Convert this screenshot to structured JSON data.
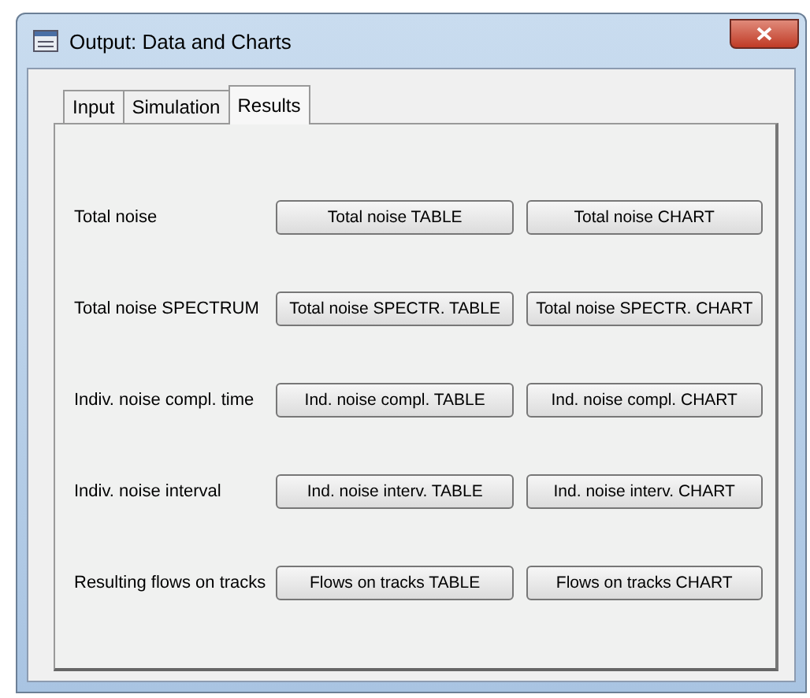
{
  "window": {
    "title": "Output: Data and Charts"
  },
  "tabs": [
    {
      "label": "Input",
      "selected": false
    },
    {
      "label": "Simulation",
      "selected": false
    },
    {
      "label": "Results",
      "selected": true
    }
  ],
  "rows": [
    {
      "label": "Total noise",
      "buttons": [
        "Total noise TABLE",
        "Total noise CHART"
      ]
    },
    {
      "label": "Total noise SPECTRUM",
      "buttons": [
        "Total noise SPECTR. TABLE",
        "Total noise SPECTR. CHART"
      ]
    },
    {
      "label": "Indiv. noise compl. time",
      "buttons": [
        "Ind. noise compl. TABLE",
        "Ind. noise compl. CHART"
      ]
    },
    {
      "label": "Indiv. noise interval",
      "buttons": [
        "Ind. noise interv. TABLE",
        "Ind. noise interv. CHART"
      ]
    },
    {
      "label": "Resulting flows on tracks",
      "buttons": [
        "Flows on tracks TABLE",
        "Flows on tracks CHART"
      ]
    }
  ]
}
